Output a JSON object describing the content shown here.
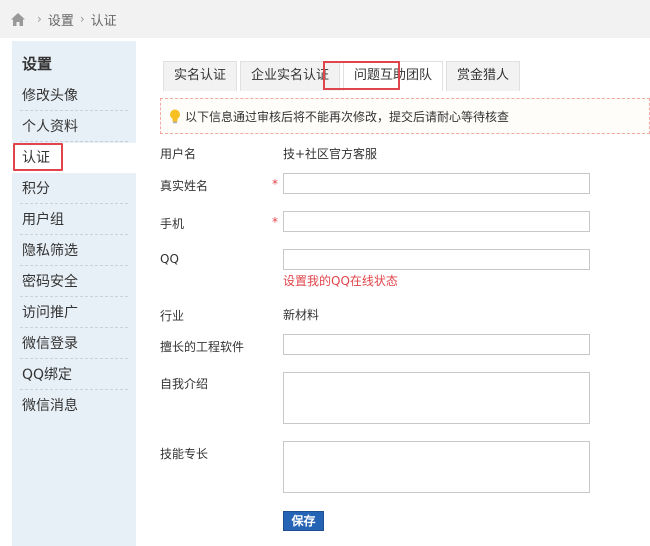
{
  "breadcrumb": {
    "items": [
      "设置",
      "认证"
    ]
  },
  "sidebar": {
    "title": "设置",
    "items": [
      {
        "label": "修改头像"
      },
      {
        "label": "个人资料"
      },
      {
        "label": "认证",
        "active": true
      },
      {
        "label": "积分"
      },
      {
        "label": "用户组"
      },
      {
        "label": "隐私筛选"
      },
      {
        "label": "密码安全"
      },
      {
        "label": "访问推广"
      },
      {
        "label": "微信登录"
      },
      {
        "label": "QQ绑定"
      },
      {
        "label": "微信消息"
      }
    ]
  },
  "tabs": [
    {
      "label": "实名认证"
    },
    {
      "label": "企业实名认证"
    },
    {
      "label": "问题互助团队",
      "active": true
    },
    {
      "label": "赏金猎人"
    }
  ],
  "notice": {
    "text": "以下信息通过审核后将不能再次修改，提交后请耐心等待核查"
  },
  "form": {
    "username_label": "用户名",
    "username_value": "技+社区官方客服",
    "realname_label": "真实姓名",
    "required_mark": "*",
    "phone_label": "手机",
    "qq_label": "QQ",
    "qq_link": "设置我的QQ在线状态",
    "industry_label": "行业",
    "industry_value": "新材料",
    "software_label": "擅长的工程软件",
    "intro_label": "自我介绍",
    "skill_label": "技能专长",
    "save_label": "保存"
  },
  "colors": {
    "accent_red": "#e0454b",
    "button_blue": "#2563b4",
    "sidebar_bg": "#e8f0f7"
  }
}
